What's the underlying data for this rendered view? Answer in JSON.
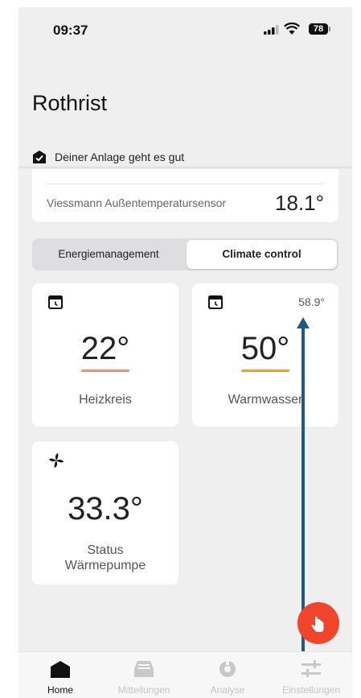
{
  "status_bar": {
    "time": "09:37",
    "battery": "78"
  },
  "header": {
    "title": "Rothrist",
    "health": "Deiner Anlage geht es gut"
  },
  "sensor": {
    "label": "Viessmann Außentemperatursensor",
    "value": "18.1°"
  },
  "segments": {
    "left": "Energiemanagement",
    "right": "Climate control",
    "selected": "right"
  },
  "cards": {
    "heating": {
      "temp": "22°",
      "label": "Heizkreis",
      "accent": "#f08a7a"
    },
    "hotwater": {
      "temp": "50°",
      "current": "58.9°",
      "label": "Warmwasser",
      "accent": "#f39a3e"
    },
    "heatpump": {
      "temp": "33.3°",
      "label": "Status Wärmepumpe"
    }
  },
  "tabs": [
    {
      "label": "Home",
      "icon": "home-icon",
      "active": true
    },
    {
      "label": "Mitteilungen",
      "icon": "inbox-icon",
      "active": false
    },
    {
      "label": "Analyse",
      "icon": "analysis-icon",
      "active": false
    },
    {
      "label": "Einstellungen",
      "icon": "settings-sliders-icon",
      "active": false
    }
  ],
  "colors": {
    "fab": "#f0452b",
    "pointer": "#1d5a84",
    "background": "#efeff0"
  }
}
